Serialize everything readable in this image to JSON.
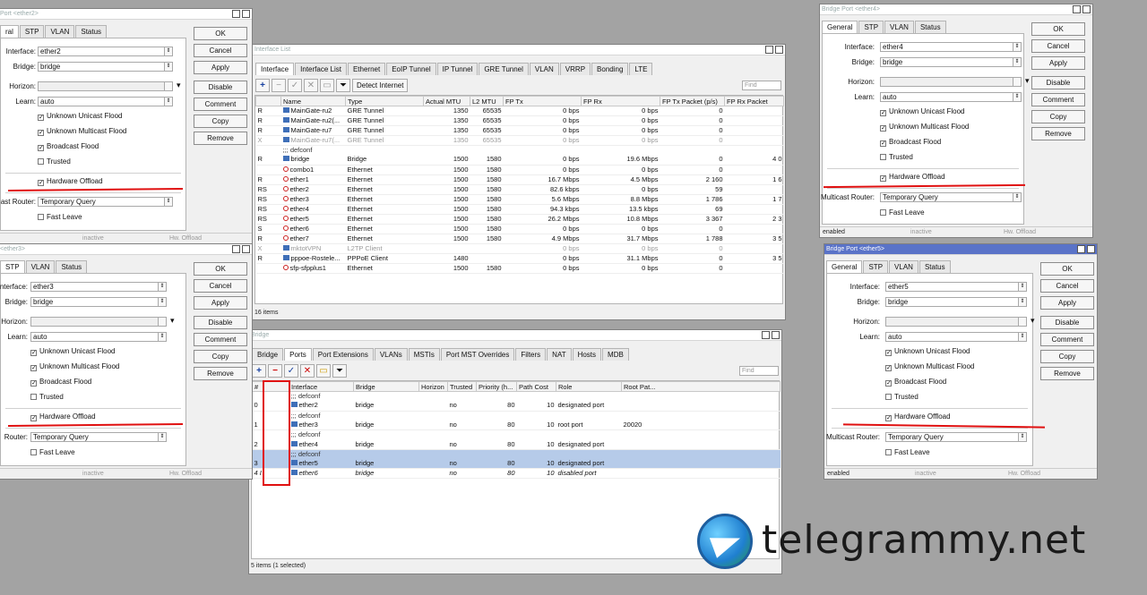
{
  "bp_ether2": {
    "title": "Port <ether2>",
    "tabs": [
      "ral",
      "STP",
      "VLAN",
      "Status"
    ],
    "fields": {
      "interface": "ether2",
      "bridge": "bridge",
      "horizon": "",
      "learn": "auto",
      "multicast_router": "Temporary Query"
    },
    "labels": {
      "interface": "Interface:",
      "bridge": "Bridge:",
      "horizon": "Horizon:",
      "learn": "Learn:",
      "multicast_router": "ast Router:"
    },
    "checks": [
      {
        "label": "Unknown Unicast Flood",
        "checked": true
      },
      {
        "label": "Unknown Multicast Flood",
        "checked": true
      },
      {
        "label": "Broadcast Flood",
        "checked": true
      },
      {
        "label": "Trusted",
        "checked": false
      }
    ],
    "hw_offload": "Hardware Offload",
    "fast_leave": "Fast Leave",
    "buttons": [
      "OK",
      "Cancel",
      "Apply",
      "Disable",
      "Comment",
      "Copy",
      "Remove"
    ],
    "status": [
      "",
      "inactive",
      "Hw. Offload"
    ]
  },
  "bp_ether3": {
    "title": "<ether3>",
    "tabs": [
      "STP",
      "VLAN",
      "Status"
    ],
    "fields": {
      "interface": "ether3",
      "bridge": "bridge",
      "horizon": "",
      "learn": "auto",
      "multicast_router": "Temporary Query"
    },
    "labels": {
      "interface": "nterface:",
      "bridge": "Bridge:",
      "horizon": "Horizon:",
      "learn": "Learn:",
      "multicast_router": "Router:"
    },
    "checks": [
      {
        "label": "Unknown Unicast Flood",
        "checked": true
      },
      {
        "label": "Unknown Multicast Flood",
        "checked": true
      },
      {
        "label": "Broadcast Flood",
        "checked": true
      },
      {
        "label": "Trusted",
        "checked": false
      }
    ],
    "hw_offload": "Hardware Offload",
    "fast_leave": "Fast Leave",
    "buttons": [
      "OK",
      "Cancel",
      "Apply",
      "Disable",
      "Comment",
      "Copy",
      "Remove"
    ],
    "status": [
      "",
      "inactive",
      "Hw. Offload"
    ]
  },
  "bp_ether4": {
    "title": "Bridge Port <ether4>",
    "tabs": [
      "General",
      "STP",
      "VLAN",
      "Status"
    ],
    "fields": {
      "interface": "ether4",
      "bridge": "bridge",
      "horizon": "",
      "learn": "auto",
      "multicast_router": "Temporary Query"
    },
    "labels": {
      "interface": "Interface:",
      "bridge": "Bridge:",
      "horizon": "Horizon:",
      "learn": "Learn:",
      "multicast_router": "Multicast Router:"
    },
    "checks": [
      {
        "label": "Unknown Unicast Flood",
        "checked": true
      },
      {
        "label": "Unknown Multicast Flood",
        "checked": true
      },
      {
        "label": "Broadcast Flood",
        "checked": true
      },
      {
        "label": "Trusted",
        "checked": false
      }
    ],
    "hw_offload": "Hardware Offload",
    "fast_leave": "Fast Leave",
    "buttons": [
      "OK",
      "Cancel",
      "Apply",
      "Disable",
      "Comment",
      "Copy",
      "Remove"
    ],
    "status": [
      "enabled",
      "inactive",
      "Hw. Offload"
    ]
  },
  "bp_ether5": {
    "title": "Bridge Port <ether5>",
    "tabs": [
      "General",
      "STP",
      "VLAN",
      "Status"
    ],
    "fields": {
      "interface": "ether5",
      "bridge": "bridge",
      "horizon": "",
      "learn": "auto",
      "multicast_router": "Temporary Query"
    },
    "labels": {
      "interface": "Interface:",
      "bridge": "Bridge:",
      "horizon": "Horizon:",
      "learn": "Learn:",
      "multicast_router": "Multicast Router:"
    },
    "checks": [
      {
        "label": "Unknown Unicast Flood",
        "checked": true
      },
      {
        "label": "Unknown Multicast Flood",
        "checked": true
      },
      {
        "label": "Broadcast Flood",
        "checked": true
      },
      {
        "label": "Trusted",
        "checked": false
      }
    ],
    "hw_offload": "Hardware Offload",
    "fast_leave": "Fast Leave",
    "buttons": [
      "OK",
      "Cancel",
      "Apply",
      "Disable",
      "Comment",
      "Copy",
      "Remove"
    ],
    "status": [
      "enabled",
      "inactive",
      "Hw. Offload"
    ]
  },
  "iflist": {
    "title": "Interface List",
    "tabs": [
      "Interface",
      "Interface List",
      "Ethernet",
      "EoIP Tunnel",
      "IP Tunnel",
      "GRE Tunnel",
      "VLAN",
      "VRRP",
      "Bonding",
      "LTE"
    ],
    "detect": "Detect Internet",
    "find": "Find",
    "columns": [
      "",
      "Name",
      "Type",
      "Actual MTU",
      "L2 MTU",
      "FP Tx",
      "FP Rx",
      "FP Tx Packet (p/s)",
      "FP Rx Packet"
    ],
    "rows": [
      {
        "f": "R",
        "name": "MainGate-ru2",
        "type": "GRE Tunnel",
        "mtu": "1350",
        "l2": "65535",
        "tx": "0 bps",
        "rx": "0 bps",
        "txp": "0",
        "rxp": "",
        "cls": "row",
        "ic": "b"
      },
      {
        "f": "R",
        "name": "MainGate-ru2(...",
        "type": "GRE Tunnel",
        "mtu": "1350",
        "l2": "65535",
        "tx": "0 bps",
        "rx": "0 bps",
        "txp": "0",
        "rxp": "",
        "cls": "row",
        "ic": "b"
      },
      {
        "f": "R",
        "name": "MainGate-ru7",
        "type": "GRE Tunnel",
        "mtu": "1350",
        "l2": "65535",
        "tx": "0 bps",
        "rx": "0 bps",
        "txp": "0",
        "rxp": "",
        "cls": "row",
        "ic": "b"
      },
      {
        "f": "X",
        "name": "MainGate-ru7(...",
        "type": "GRE Tunnel",
        "mtu": "1350",
        "l2": "65535",
        "tx": "0 bps",
        "rx": "0 bps",
        "txp": "0",
        "rxp": "",
        "cls": "row dis",
        "ic": "b"
      },
      {
        "f": "",
        "name": ";;; defconf",
        "type": "",
        "mtu": "",
        "l2": "",
        "tx": "",
        "rx": "",
        "txp": "",
        "rxp": "",
        "cls": "comment",
        "ic": ""
      },
      {
        "f": "R",
        "name": "bridge",
        "type": "Bridge",
        "mtu": "1500",
        "l2": "1580",
        "tx": "0 bps",
        "rx": "19.6 Mbps",
        "txp": "0",
        "rxp": "4 0",
        "cls": "row",
        "ic": "b"
      },
      {
        "f": "",
        "name": "combo1",
        "type": "Ethernet",
        "mtu": "1500",
        "l2": "1580",
        "tx": "0 bps",
        "rx": "0 bps",
        "txp": "0",
        "rxp": "",
        "cls": "row",
        "ic": "r"
      },
      {
        "f": "R",
        "name": "ether1",
        "type": "Ethernet",
        "mtu": "1500",
        "l2": "1580",
        "tx": "16.7 Mbps",
        "rx": "4.5 Mbps",
        "txp": "2 160",
        "rxp": "1 6",
        "cls": "row",
        "ic": "r"
      },
      {
        "f": "RS",
        "name": "ether2",
        "type": "Ethernet",
        "mtu": "1500",
        "l2": "1580",
        "tx": "82.6 kbps",
        "rx": "0 bps",
        "txp": "59",
        "rxp": "",
        "cls": "row",
        "ic": "r"
      },
      {
        "f": "RS",
        "name": "ether3",
        "type": "Ethernet",
        "mtu": "1500",
        "l2": "1580",
        "tx": "5.6 Mbps",
        "rx": "8.8 Mbps",
        "txp": "1 786",
        "rxp": "1 7",
        "cls": "row",
        "ic": "r"
      },
      {
        "f": "RS",
        "name": "ether4",
        "type": "Ethernet",
        "mtu": "1500",
        "l2": "1580",
        "tx": "94.3 kbps",
        "rx": "13.5 kbps",
        "txp": "69",
        "rxp": "",
        "cls": "row",
        "ic": "r"
      },
      {
        "f": "RS",
        "name": "ether5",
        "type": "Ethernet",
        "mtu": "1500",
        "l2": "1580",
        "tx": "26.2 Mbps",
        "rx": "10.8 Mbps",
        "txp": "3 367",
        "rxp": "2 3",
        "cls": "row",
        "ic": "r"
      },
      {
        "f": "S",
        "name": "ether6",
        "type": "Ethernet",
        "mtu": "1500",
        "l2": "1580",
        "tx": "0 bps",
        "rx": "0 bps",
        "txp": "0",
        "rxp": "",
        "cls": "row",
        "ic": "r"
      },
      {
        "f": "R",
        "name": "ether7",
        "type": "Ethernet",
        "mtu": "1500",
        "l2": "1580",
        "tx": "4.9 Mbps",
        "rx": "31.7 Mbps",
        "txp": "1 788",
        "rxp": "3 5",
        "cls": "row",
        "ic": "r"
      },
      {
        "f": "X",
        "name": "mktotVPN",
        "type": "L2TP Client",
        "mtu": "",
        "l2": "",
        "tx": "0 bps",
        "rx": "0 bps",
        "txp": "0",
        "rxp": "",
        "cls": "row dis",
        "ic": "b"
      },
      {
        "f": "R",
        "name": "pppoe-Rostele...",
        "type": "PPPoE Client",
        "mtu": "1480",
        "l2": "",
        "tx": "0 bps",
        "rx": "31.1 Mbps",
        "txp": "0",
        "rxp": "3 5",
        "cls": "row",
        "ic": "b"
      },
      {
        "f": "",
        "name": "sfp-sfpplus1",
        "type": "Ethernet",
        "mtu": "1500",
        "l2": "1580",
        "tx": "0 bps",
        "rx": "0 bps",
        "txp": "0",
        "rxp": "",
        "cls": "row",
        "ic": "r"
      }
    ],
    "count": "16 items"
  },
  "bridge": {
    "title": "Bridge",
    "tabs": [
      "Bridge",
      "Ports",
      "Port Extensions",
      "VLANs",
      "MSTIs",
      "Port MST Overrides",
      "Filters",
      "NAT",
      "Hosts",
      "MDB"
    ],
    "find": "Find",
    "columns": [
      "#",
      "Interface",
      "Bridge",
      "Horizon",
      "Trusted",
      "Priority (h...",
      "Path Cost",
      "Role",
      "Root Pat..."
    ],
    "rows": [
      {
        "n": "",
        "iface": ";;; defconf",
        "bridge": "",
        "horizon": "",
        "trusted": "",
        "prio": "",
        "cost": "",
        "role": "",
        "root": "",
        "cls": "comment"
      },
      {
        "n": "0",
        "iface": "ether2",
        "bridge": "bridge",
        "horizon": "",
        "trusted": "no",
        "prio": "80",
        "cost": "10",
        "role": "designated port",
        "root": "",
        "cls": "row"
      },
      {
        "n": "",
        "iface": ";;; defconf",
        "bridge": "",
        "horizon": "",
        "trusted": "",
        "prio": "",
        "cost": "",
        "role": "",
        "root": "",
        "cls": "comment"
      },
      {
        "n": "1",
        "iface": "ether3",
        "bridge": "bridge",
        "horizon": "",
        "trusted": "no",
        "prio": "80",
        "cost": "10",
        "role": "root port",
        "root": "20020",
        "cls": "row"
      },
      {
        "n": "",
        "iface": ";;; defconf",
        "bridge": "",
        "horizon": "",
        "trusted": "",
        "prio": "",
        "cost": "",
        "role": "",
        "root": "",
        "cls": "comment"
      },
      {
        "n": "2",
        "iface": "ether4",
        "bridge": "bridge",
        "horizon": "",
        "trusted": "no",
        "prio": "80",
        "cost": "10",
        "role": "designated port",
        "root": "",
        "cls": "row"
      },
      {
        "n": "",
        "iface": ";;; defconf",
        "bridge": "",
        "horizon": "",
        "trusted": "",
        "prio": "",
        "cost": "",
        "role": "",
        "root": "",
        "cls": "comment sel"
      },
      {
        "n": "3",
        "iface": "ether5",
        "bridge": "bridge",
        "horizon": "",
        "trusted": "no",
        "prio": "80",
        "cost": "10",
        "role": "designated port",
        "root": "",
        "cls": "row sel"
      },
      {
        "n": "4 I",
        "iface": "ether6",
        "bridge": "bridge",
        "horizon": "",
        "trusted": "no",
        "prio": "80",
        "cost": "10",
        "role": "disabled port",
        "root": "",
        "cls": "row"
      }
    ],
    "count": "5 items (1 selected)"
  },
  "watermark": {
    "text": "telegrammy.net"
  },
  "colors": {
    "annotation_red": "#e01010",
    "selected_row": "#b6cbe9",
    "active_titlebar": "#5a73c8"
  }
}
